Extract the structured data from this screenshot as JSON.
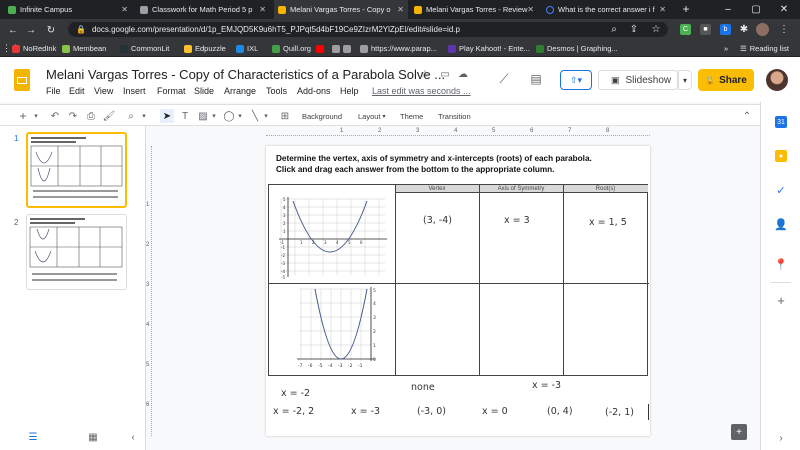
{
  "tabs": [
    {
      "label": "Infinite Campus",
      "color": "#4caf50"
    },
    {
      "label": "Classwork for Math Period 5 p",
      "color": "#9aa0a6"
    },
    {
      "label": "Melani Vargas Torres - Copy o",
      "color": "#f4b400"
    },
    {
      "label": "Melani Vargas Torres - Review",
      "color": "#f4b400"
    },
    {
      "label": "What is the correct answer i f",
      "color": "#4285f4"
    }
  ],
  "address": {
    "url": "docs.google.com/presentation/d/1p_EMJQD5K9u6hT5_PJPqt5d4bF19Ce9ZIzrM2YlZpEl/edit#slide=id.p"
  },
  "bookmarks": [
    "NoRedInk",
    "Membean",
    "CommonLit",
    "Edpuzzle",
    "IXL",
    "Quill.org",
    "",
    "https://www.parap...",
    "Play Kahoot! - Ente...",
    "Desmos | Graphing..."
  ],
  "reading_list": "Reading list",
  "doc": {
    "title": "Melani Vargas Torres - Copy of Characteristics of a Parabola Solve ...",
    "menus": [
      "File",
      "Edit",
      "View",
      "Insert",
      "Format",
      "Slide",
      "Arrange",
      "Tools",
      "Add-ons",
      "Help"
    ],
    "last_edit": "Last edit was seconds ...",
    "slideshow": "Slideshow",
    "share": "Share"
  },
  "toolbar": {
    "background": "Background",
    "layout": "Layout",
    "theme": "Theme",
    "transition": "Transition"
  },
  "slides": [
    {
      "num": "1"
    },
    {
      "num": "2"
    }
  ],
  "slide": {
    "instruction_line1": "Determine the vertex, axis of symmetry and x-intercepts  (roots)  of each parabola.",
    "instruction_line2": "Click and drag each answer from the bottom to the appropriate column.",
    "headers": [
      "Vertex",
      "Axis of Symmetry",
      "Root(s)"
    ],
    "row1": {
      "vertex": "(3, -4)",
      "axis": "x = 3",
      "roots": "x = 1, 5"
    },
    "graph1_xticks": [
      "-1",
      "1",
      "2",
      "3",
      "4",
      "5",
      "6"
    ],
    "graph1_yticks": [
      "5",
      "4",
      "3",
      "2",
      "1",
      "-1",
      "-2",
      "-3",
      "-4",
      "-5"
    ],
    "graph2_xticks": [
      "-7",
      "-6",
      "-5",
      "-4",
      "-3",
      "-2",
      "-1"
    ],
    "graph2_yticks": [
      "5",
      "4",
      "3",
      "2",
      "1",
      "0"
    ],
    "answers": {
      "a1": "x = -2",
      "a2": "none",
      "a3": "x = -3",
      "a4": "x = -2, 2",
      "a5": "x = -3",
      "a6": "(-3, 0)",
      "a7": "x = 0",
      "a8": "(0, 4)",
      "a9": "(-2, 1)"
    }
  },
  "colors": {
    "share": "#fbbc04",
    "slideshow_border": "#dadce0",
    "accent": "#1a73e8"
  }
}
